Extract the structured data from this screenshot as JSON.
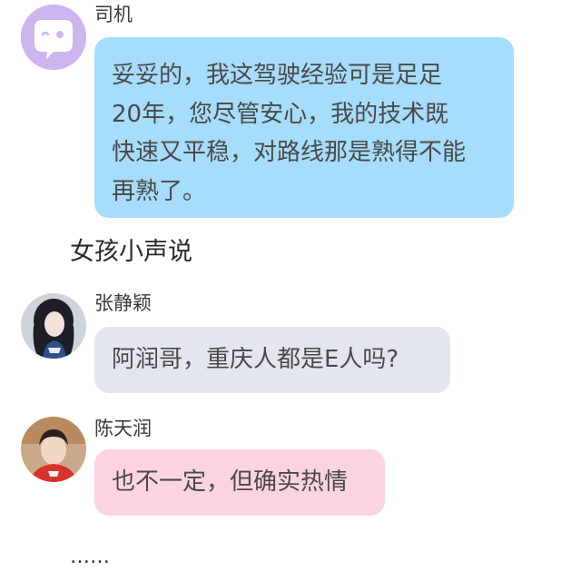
{
  "messages": [
    {
      "sender": "司机",
      "text_lines": [
        "妥妥的，我这驾驶经验可是足足",
        "20年，您尽管安心，我的技术既",
        "快速又平稳，对路线那是熟得不能",
        "再熟了。"
      ],
      "bubble_color": "#a6dcfc",
      "avatar": "chat-bot-icon"
    },
    {
      "sender": "张静颖",
      "text": "阿润哥，重庆人都是E人吗?",
      "bubble_color": "#e3e6ee",
      "avatar": "girl-portrait"
    },
    {
      "sender": "陈天润",
      "text": "也不一定，但确实热情",
      "bubble_color": "#fbd4df",
      "avatar": "boy-portrait"
    }
  ],
  "narrations": {
    "whisper": "女孩小声说",
    "ellipsis": "……"
  },
  "colors": {
    "bot_avatar_bg": "#cdb6ef",
    "background": "#ffffff"
  }
}
